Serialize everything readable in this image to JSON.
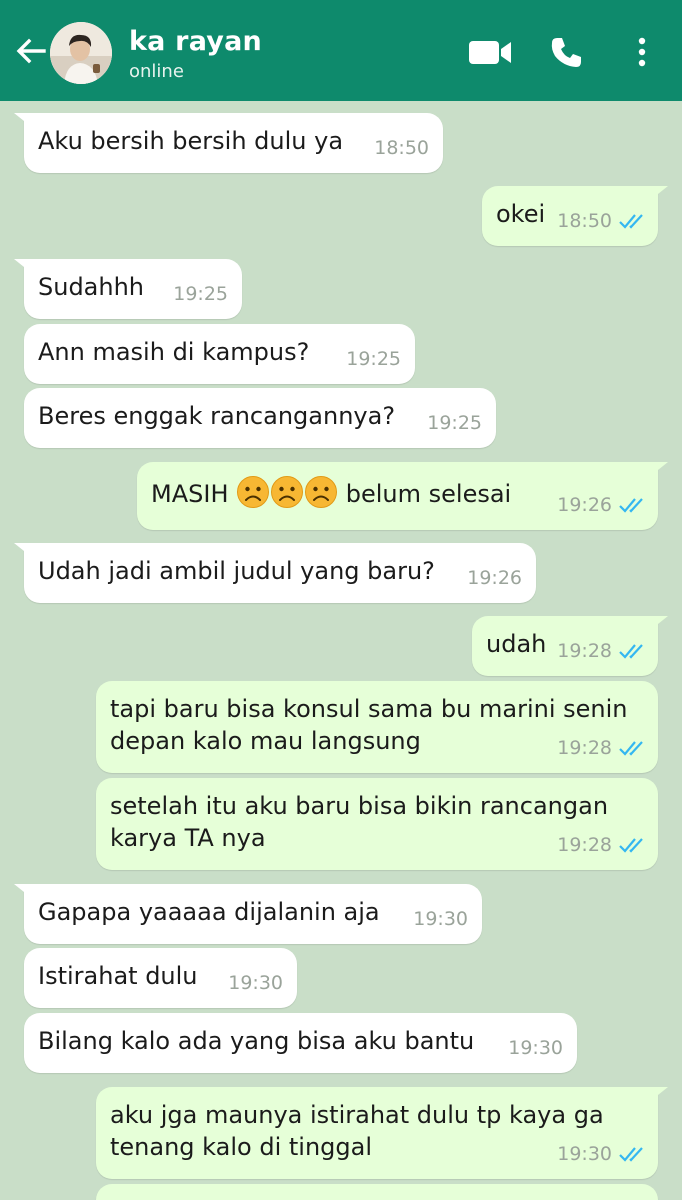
{
  "header": {
    "contact_name": "ka rayan",
    "status": "online",
    "icons": [
      "back-arrow-icon",
      "video-call-icon",
      "phone-icon",
      "more-vert-icon"
    ],
    "color": "#0e8a6c"
  },
  "messages": [
    {
      "dir": "in",
      "text": "Aku bersih bersih dulu ya",
      "time": "18:50"
    },
    {
      "dir": "out",
      "text": "okei",
      "time": "18:50"
    },
    {
      "dir": "in",
      "text": "Sudahhh",
      "time": "19:25"
    },
    {
      "dir": "in",
      "text": "Ann masih di kampus?",
      "time": "19:25"
    },
    {
      "dir": "in",
      "text": "Beres enggak rancangannya?",
      "time": "19:25"
    },
    {
      "dir": "out",
      "text_before": "MASIH",
      "emoji": "frowning-face",
      "emoji_count": 3,
      "text_after": "belum selesai",
      "time": "19:26"
    },
    {
      "dir": "in",
      "text": "Udah jadi ambil judul yang baru?",
      "time": "19:26"
    },
    {
      "dir": "out",
      "text": "udah",
      "time": "19:28"
    },
    {
      "dir": "out",
      "text": "tapi baru bisa konsul sama bu marini senin\ndepan kalo mau langsung",
      "time": "19:28"
    },
    {
      "dir": "out",
      "text": "setelah itu aku baru bisa bikin rancangan\nkarya TA nya",
      "time": "19:28"
    },
    {
      "dir": "in",
      "text": "Gapapa yaaaaa dijalanin aja",
      "time": "19:30"
    },
    {
      "dir": "in",
      "text": "Istirahat dulu",
      "time": "19:30"
    },
    {
      "dir": "in",
      "text": "Bilang kalo ada yang bisa aku bantu",
      "time": "19:30"
    },
    {
      "dir": "out",
      "text": "aku jga maunya istirahat dulu tp kaya ga\ntenang kalo di tinggal",
      "time": "19:30"
    }
  ],
  "colors": {
    "background": "#c9dec8",
    "incoming": "#ffffff",
    "outgoing": "#e6ffd8",
    "read_tick": "#34b7f1"
  }
}
